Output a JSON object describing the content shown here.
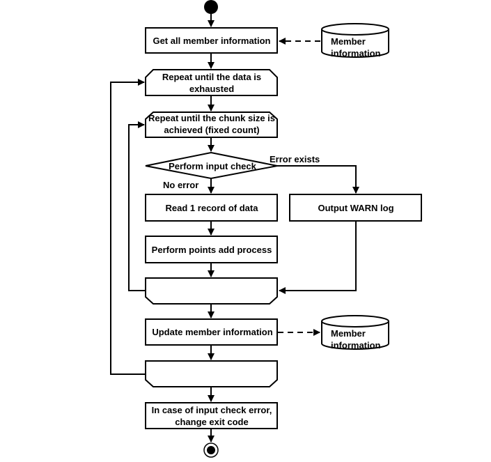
{
  "diagram": {
    "type": "activity-flowchart",
    "nodes": {
      "get_all": {
        "label": [
          "Get all member information"
        ]
      },
      "loop_data": {
        "label": [
          "Repeat until the data is",
          "exhausted"
        ]
      },
      "loop_chunk": {
        "label": [
          "Repeat until the chunk size is",
          "achieved (fixed count)"
        ]
      },
      "input_check": {
        "label": [
          "Perform input check"
        ]
      },
      "read_record": {
        "label": [
          "Read 1 record of data"
        ]
      },
      "warn_log": {
        "label": [
          "Output WARN log"
        ]
      },
      "points_add": {
        "label": [
          "Perform points add process"
        ]
      },
      "update_member": {
        "label": [
          "Update member information"
        ]
      },
      "exit_code": {
        "label": [
          "In case of input check error,",
          "change exit code"
        ]
      },
      "db_top": {
        "label": [
          "Member",
          "information"
        ]
      },
      "db_bottom": {
        "label": [
          "Member",
          "information"
        ]
      }
    },
    "edge_labels": {
      "error_exists": "Error exists",
      "no_error": "No error"
    }
  }
}
